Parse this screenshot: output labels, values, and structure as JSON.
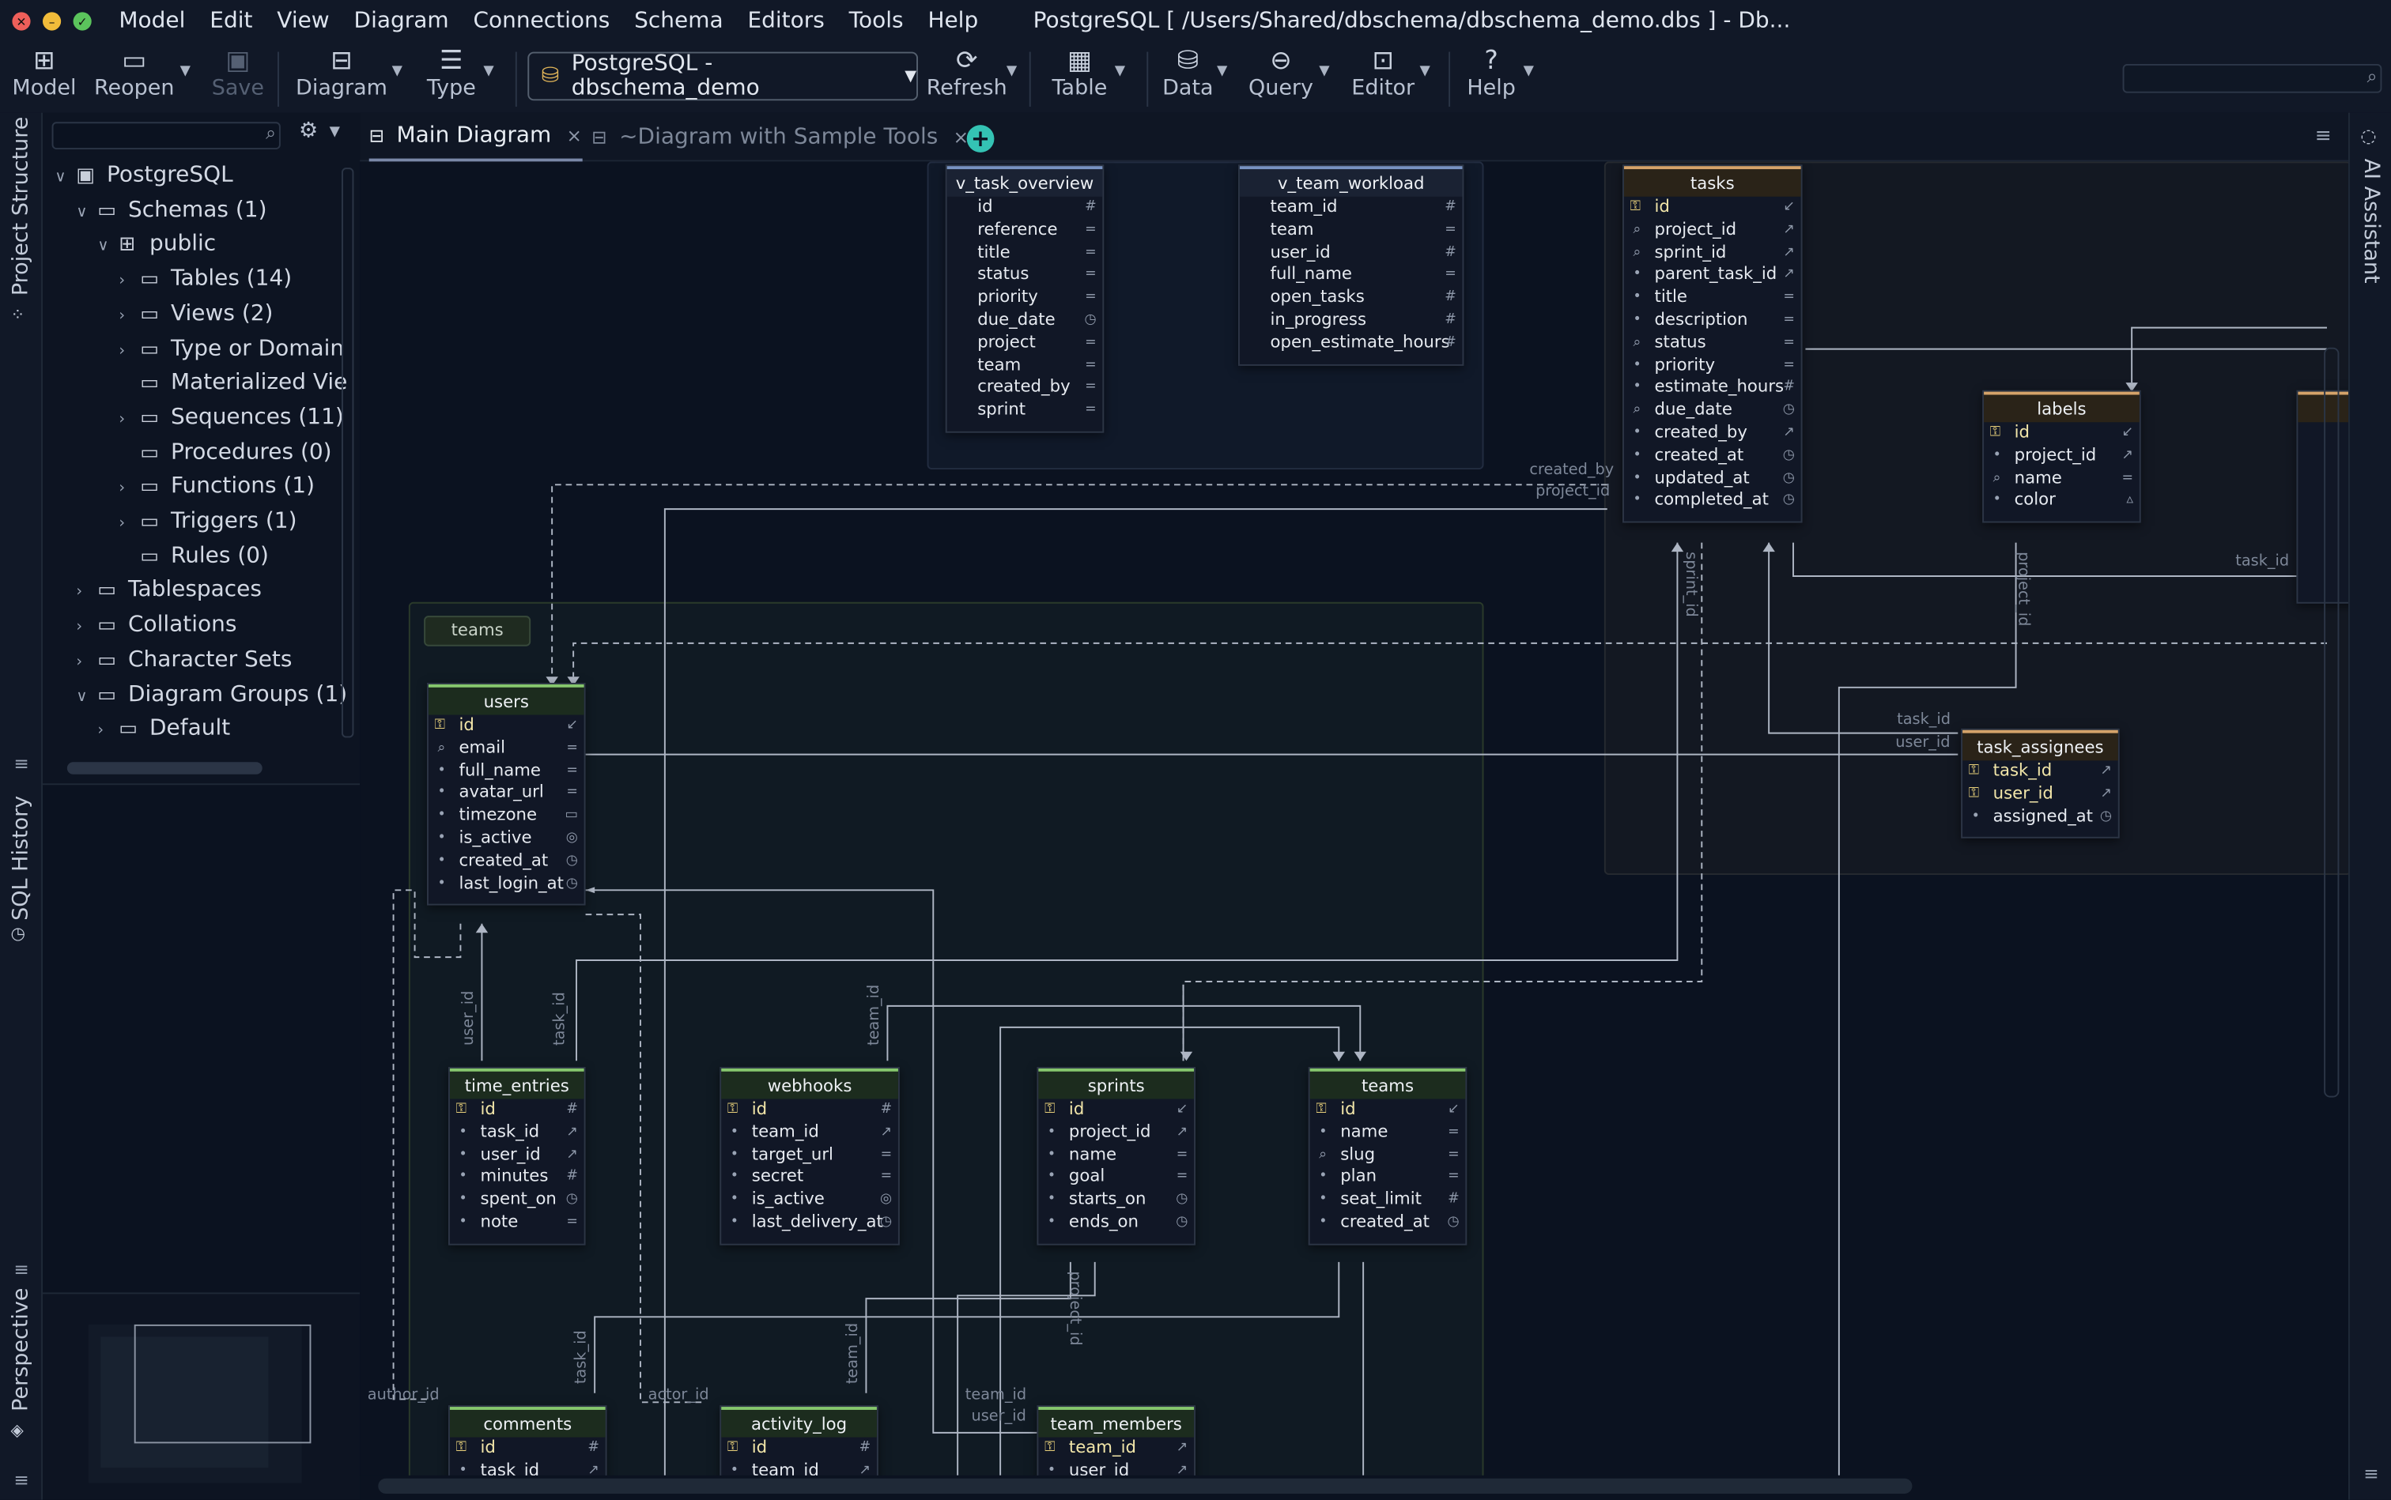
{
  "window": {
    "title": "PostgreSQL [ /Users/Shared/dbschema/dbschema_demo.dbs ] - Db..."
  },
  "menu": [
    "Model",
    "Edit",
    "View",
    "Diagram",
    "Connections",
    "Schema",
    "Editors",
    "Tools",
    "Help"
  ],
  "toolbar": {
    "model": "Model",
    "reopen": "Reopen",
    "save": "Save",
    "diagram": "Diagram",
    "type": "Type",
    "connection": "PostgreSQL - dbschema_demo",
    "refresh": "Refresh",
    "table": "Table",
    "data": "Data",
    "query": "Query",
    "editor": "Editor",
    "help": "Help"
  },
  "side": {
    "project_structure": "Project Structure",
    "sql_history": "SQL History",
    "perspective": "Perspective",
    "ai_assistant": "AI Assistant"
  },
  "tree": [
    {
      "label": "PostgreSQL",
      "level": 0,
      "arrow": "down"
    },
    {
      "label": "Schemas (1)",
      "level": 1,
      "arrow": "down"
    },
    {
      "label": "public",
      "level": 2,
      "arrow": "down"
    },
    {
      "label": "Tables (14)",
      "level": 3,
      "arrow": "right"
    },
    {
      "label": "Views (2)",
      "level": 3,
      "arrow": "right"
    },
    {
      "label": "Type or Domain",
      "level": 3,
      "arrow": "right"
    },
    {
      "label": "Materialized Vie",
      "level": 3,
      "arrow": ""
    },
    {
      "label": "Sequences (11)",
      "level": 3,
      "arrow": "right"
    },
    {
      "label": "Procedures (0)",
      "level": 3,
      "arrow": ""
    },
    {
      "label": "Functions (1)",
      "level": 3,
      "arrow": "right"
    },
    {
      "label": "Triggers (1)",
      "level": 3,
      "arrow": "right"
    },
    {
      "label": "Rules (0)",
      "level": 3,
      "arrow": ""
    },
    {
      "label": "Tablespaces",
      "level": 1,
      "arrow": "right"
    },
    {
      "label": "Collations",
      "level": 1,
      "arrow": "right"
    },
    {
      "label": "Character Sets",
      "level": 1,
      "arrow": "right"
    },
    {
      "label": "Diagram Groups (1)",
      "level": 1,
      "arrow": "down"
    },
    {
      "label": "Default",
      "level": 2,
      "arrow": "right"
    }
  ],
  "tabs": {
    "main": "Main Diagram",
    "sample": "~Diagram with Sample Tools"
  },
  "groups": {
    "teams": "teams"
  },
  "entities": {
    "v_task_overview": {
      "name": "v_task_overview",
      "cols": [
        "id",
        "reference",
        "title",
        "status",
        "priority",
        "due_date",
        "project",
        "team",
        "created_by",
        "sprint"
      ]
    },
    "v_team_workload": {
      "name": "v_team_workload",
      "cols": [
        "team_id",
        "team",
        "user_id",
        "full_name",
        "open_tasks",
        "in_progress",
        "open_estimate_hours"
      ]
    },
    "tasks": {
      "name": "tasks",
      "cols": [
        "id",
        "project_id",
        "sprint_id",
        "parent_task_id",
        "title",
        "description",
        "status",
        "priority",
        "estimate_hours",
        "due_date",
        "created_by",
        "created_at",
        "updated_at",
        "completed_at"
      ]
    },
    "labels": {
      "name": "labels",
      "cols": [
        "id",
        "project_id",
        "name",
        "color"
      ]
    },
    "users": {
      "name": "users",
      "cols": [
        "id",
        "email",
        "full_name",
        "avatar_url",
        "timezone",
        "is_active",
        "created_at",
        "last_login_at"
      ]
    },
    "task_assignees": {
      "name": "task_assignees",
      "cols": [
        "task_id",
        "user_id",
        "assigned_at"
      ]
    },
    "time_entries": {
      "name": "time_entries",
      "cols": [
        "id",
        "task_id",
        "user_id",
        "minutes",
        "spent_on",
        "note"
      ]
    },
    "webhooks": {
      "name": "webhooks",
      "cols": [
        "id",
        "team_id",
        "target_url",
        "secret",
        "is_active",
        "last_delivery_at"
      ]
    },
    "sprints": {
      "name": "sprints",
      "cols": [
        "id",
        "project_id",
        "name",
        "goal",
        "starts_on",
        "ends_on"
      ]
    },
    "teams": {
      "name": "teams",
      "cols": [
        "id",
        "name",
        "slug",
        "plan",
        "seat_limit",
        "created_at"
      ]
    },
    "comments": {
      "name": "comments",
      "cols": [
        "id",
        "task_id"
      ]
    },
    "activity_log": {
      "name": "activity_log",
      "cols": [
        "id",
        "team_id"
      ]
    },
    "team_members": {
      "name": "team_members",
      "cols": [
        "team_id",
        "user_id"
      ]
    }
  },
  "edge_labels": {
    "created_by": "created_by",
    "project_id": "project_id",
    "sprint_id": "sprint_id",
    "task_id": "task_id",
    "user_id": "user_id",
    "team_id": "team_id",
    "author_id": "author_id",
    "actor_id": "actor_id"
  }
}
